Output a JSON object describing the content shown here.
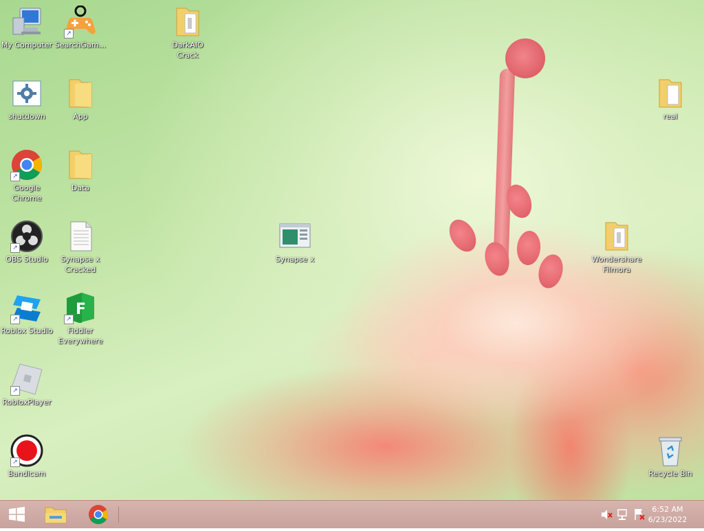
{
  "desktop": {
    "icons": [
      {
        "id": "my-computer",
        "label": "My Computer"
      },
      {
        "id": "searchgames",
        "label": "SearchGam..."
      },
      {
        "id": "darkaio",
        "label": "DarkAIO Crack"
      },
      {
        "id": "shutdown",
        "label": "shutdown"
      },
      {
        "id": "app",
        "label": "App"
      },
      {
        "id": "real",
        "label": "real"
      },
      {
        "id": "chrome",
        "label": "Google Chrome"
      },
      {
        "id": "data",
        "label": "Data"
      },
      {
        "id": "obs",
        "label": "OBS Studio"
      },
      {
        "id": "synapsex-cracked",
        "label": "Synapse x Cracked"
      },
      {
        "id": "synapsex",
        "label": "Synapse x"
      },
      {
        "id": "filmora",
        "label": "Wondershare Filmora"
      },
      {
        "id": "roblox-studio",
        "label": "Roblox Studio"
      },
      {
        "id": "fiddler",
        "label": "Fiddler Everywhere"
      },
      {
        "id": "roblox-player",
        "label": "RobloxPlayer"
      },
      {
        "id": "bandicam",
        "label": "Bandicam"
      },
      {
        "id": "recycle-bin",
        "label": "Recycle Bin"
      }
    ]
  },
  "taskbar": {
    "clock": {
      "time": "6:52 AM",
      "date": "6/23/2022"
    }
  },
  "colors": {
    "taskbar": "#c8a29c",
    "folder": "#f2cf6a"
  }
}
